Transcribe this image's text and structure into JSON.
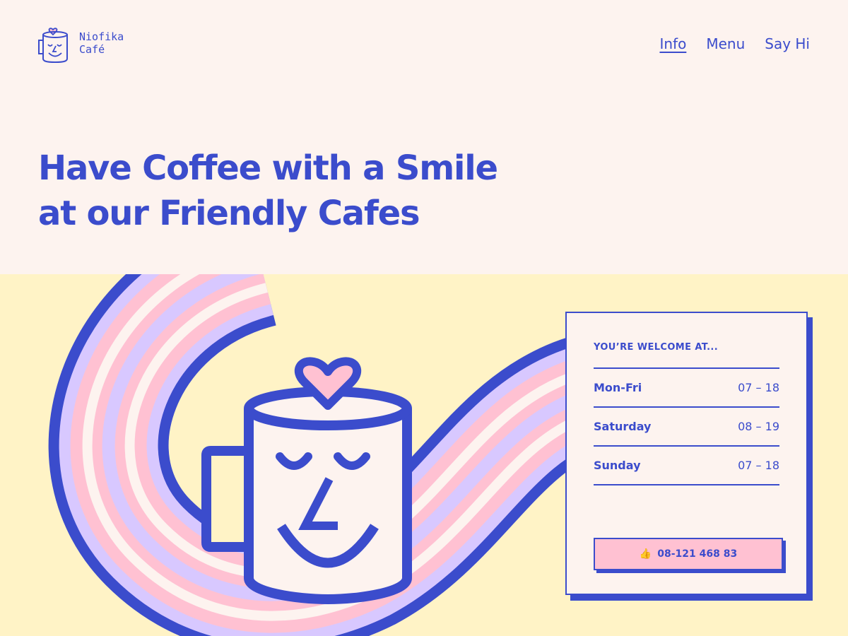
{
  "brand": {
    "name_line1": "Niofika",
    "name_line2": "Café"
  },
  "nav": {
    "items": [
      "Info",
      "Menu",
      "Say Hi"
    ],
    "active": "Info"
  },
  "hero": {
    "line1": "Have Coffee with a Smile",
    "line2": "at our Friendly Cafes"
  },
  "hours_card": {
    "heading": "YOU’RE WELCOME AT...",
    "rows": [
      {
        "day": "Mon-Fri",
        "time": "07 – 18"
      },
      {
        "day": "Saturday",
        "time": "08 – 19"
      },
      {
        "day": "Sunday",
        "time": "07 – 18"
      }
    ],
    "phone": "08-121 468 83",
    "phone_icon": "thumbs-up-icon"
  },
  "colors": {
    "primary_blue": "#3b4ccc",
    "cream": "#fdf3ef",
    "yellow": "#fff3c6",
    "pink": "#ffc1d2",
    "lavender": "#d8c8ff"
  }
}
